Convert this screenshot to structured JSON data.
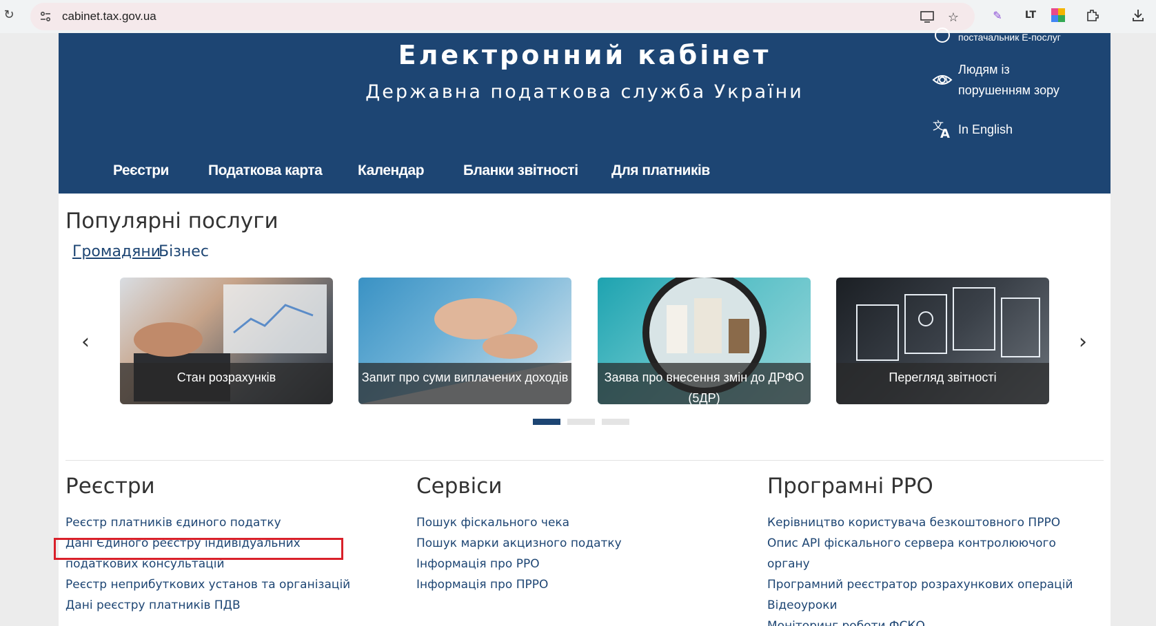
{
  "browser": {
    "url": "cabinet.tax.gov.ua"
  },
  "header": {
    "title": "Електронний кабінет",
    "subtitle": "Державна податкова служба України",
    "utility_links": [
      {
        "label": "постачальник Е-послуг",
        "icon": "user-icon"
      },
      {
        "label": "Людям із\nпорушенням зору",
        "icon": "eye-icon"
      },
      {
        "label": "In English",
        "icon": "translate-icon"
      }
    ]
  },
  "nav": {
    "items": [
      "Реєстри",
      "Податкова карта",
      "Календар",
      "Бланки звітності",
      "Для платників"
    ]
  },
  "popular": {
    "title": "Популярні послуги",
    "tabs": [
      {
        "label": "Громадяни",
        "active": true
      },
      {
        "label": "Бізнес",
        "active": false
      }
    ],
    "cards": [
      {
        "caption": "Стан розрахунків"
      },
      {
        "caption": "Запит про суми виплачених доходів"
      },
      {
        "caption": "Заява про внесення змін до ДРФО (5ДР)"
      },
      {
        "caption": "Перегляд звітності"
      }
    ],
    "active_slide": 1,
    "slide_count": 3
  },
  "columns": [
    {
      "title": "Реєстри",
      "links": [
        "Реєстр платників єдиного податку",
        "Дані Єдиного реєстру індивідуальних податкових консультацій",
        "Реєстр неприбуткових установ та організацій",
        "Дані реєстру платників ПДВ"
      ]
    },
    {
      "title": "Сервіси",
      "links": [
        "Пошук фіскального чека",
        "Пошук марки акцизного податку",
        "Інформація про РРО",
        "Інформація про ПРРО"
      ]
    },
    {
      "title": "Програмні РРО",
      "links": [
        "Керівництво користувача безкоштовного ПРРО",
        "Опис API фіскального сервера контролюючого органу",
        "Програмний реєстратор розрахункових операцій",
        "Відеоуроки",
        "Моніторинг роботи ФСКО"
      ]
    }
  ],
  "colors": {
    "header_bg": "#1d4573",
    "link": "#1d4573",
    "highlight": "#d9202a"
  }
}
